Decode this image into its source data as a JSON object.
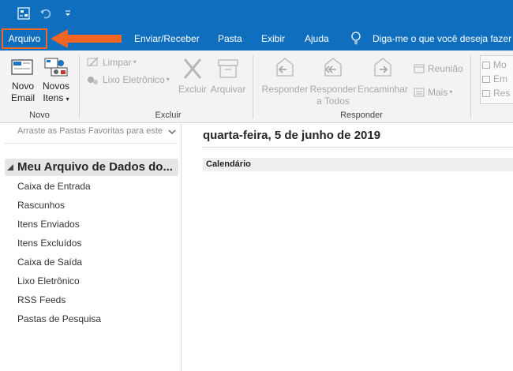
{
  "quick_access": {
    "send_receive_icon": "send-receive-all-icon",
    "undo_icon": "undo-icon",
    "customize_icon": "customize-quick-access-icon"
  },
  "tabs": {
    "file": "Arquivo",
    "send_receive": "Enviar/Receber",
    "folder": "Pasta",
    "view": "Exibir",
    "help": "Ajuda",
    "tell_me": "Diga-me o que você deseja fazer"
  },
  "ribbon": {
    "new_email_line1": "Novo",
    "new_email_line2": "Email",
    "new_items_line1": "Novos",
    "new_items_line2": "Itens",
    "group_new": "Novo",
    "clean": "Limpar",
    "junk": "Lixo Eletrônico",
    "delete": "Excluir",
    "archive": "Arquivar",
    "group_delete": "Excluir",
    "reply": "Responder",
    "reply_all_line1": "Responder",
    "reply_all_line2": "a Todos",
    "forward": "Encaminhar",
    "meeting": "Reunião",
    "more": "Mais",
    "group_respond": "Responder",
    "quick_steps_1": "Mo",
    "quick_steps_2": "Em",
    "quick_steps_3": "Res"
  },
  "nav": {
    "favorites_hint": "Arraste as Pastas Favoritas para este",
    "account": "Meu Arquivo de Dados do...",
    "folders": [
      "Caixa de Entrada",
      "Rascunhos",
      "Itens Enviados",
      "Itens Excluídos",
      "Caixa de Saída",
      "Lixo Eletrônico",
      "RSS Feeds",
      "Pastas de Pesquisa"
    ]
  },
  "main": {
    "date": "quarta-feira, 5 de junho de 2019",
    "calendar_label": "Calendário"
  },
  "colors": {
    "titlebar": "#106ebe",
    "highlight": "#f26522",
    "ribbon_bg": "#f3f3f3"
  }
}
